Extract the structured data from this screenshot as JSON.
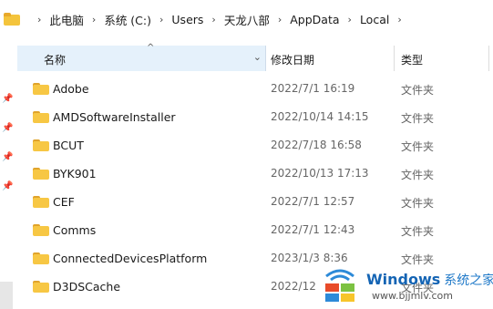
{
  "address_bar": {
    "crumbs": [
      "此电脑",
      "系统 (C:)",
      "Users",
      "天龙八部",
      "AppData",
      "Local"
    ]
  },
  "columns": {
    "name": "名称",
    "date": "修改日期",
    "type": "类型"
  },
  "rows": [
    {
      "name": "Adobe",
      "date": "2022/7/1 16:19",
      "type": "文件夹"
    },
    {
      "name": "AMDSoftwareInstaller",
      "date": "2022/10/14 14:15",
      "type": "文件夹"
    },
    {
      "name": "BCUT",
      "date": "2022/7/18 16:58",
      "type": "文件夹"
    },
    {
      "name": "BYK901",
      "date": "2022/10/13 17:13",
      "type": "文件夹"
    },
    {
      "name": "CEF",
      "date": "2022/7/1 12:57",
      "type": "文件夹"
    },
    {
      "name": "Comms",
      "date": "2022/7/1 12:43",
      "type": "文件夹"
    },
    {
      "name": "ConnectedDevicesPlatform",
      "date": "2023/1/3 8:36",
      "type": "文件夹"
    },
    {
      "name": "D3DSCache",
      "date": "2022/12",
      "type": "文件夹"
    }
  ],
  "watermark": {
    "brand": "Windows",
    "brand_cn": "系统之家",
    "url": "www.bjjmlv.com"
  },
  "colors": {
    "folder": "#f7c744",
    "header_selected": "#e5f1fb",
    "watermark_blue": "#1464b4"
  }
}
